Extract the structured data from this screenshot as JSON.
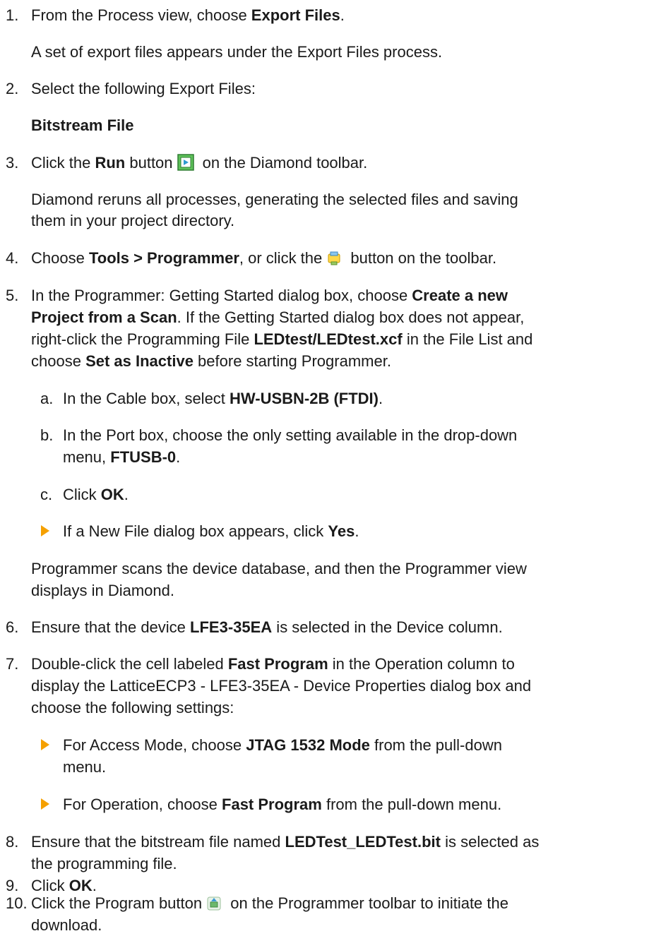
{
  "steps": [
    {
      "num": "1.",
      "pre": "From the Process view, choose ",
      "bold": "Export Files",
      "post": "."
    },
    {
      "note": "A set of export files appears under the Export Files process."
    },
    {
      "num": "2.",
      "text": "Select the following Export Files:"
    },
    {
      "boldline": "Bitstream File"
    },
    {
      "num": "3.",
      "pre": "Click the ",
      "bold": "Run",
      "post_a": " button",
      "post_b": " on the Diamond toolbar.",
      "icon": "run-icon"
    },
    {
      "note_l1": "Diamond reruns all processes, generating the selected files and saving",
      "note_l2": "them in your project directory."
    },
    {
      "num": "4.",
      "pre": "Choose ",
      "bold": "Tools > Programmer",
      "post_a": ", or click the",
      "post_b": " button on the toolbar.",
      "icon": "programmer-icon"
    },
    {
      "num": "5.",
      "l1_pre": "In the Programmer: Getting Started dialog box, choose ",
      "l1_bold": "Create a new",
      "l2_bold": "Project from a Scan",
      "l2_post": ". If the Getting Started dialog box does not appear,",
      "l3_pre": "right-click the Programming File ",
      "l3_bold": "LEDtest/LEDtest.xcf",
      "l3_post": " in the File List and",
      "l4_pre": "choose ",
      "l4_bold": "Set as Inactive",
      "l4_post": " before starting Programmer."
    },
    {
      "letter": "a.",
      "pre": "In the Cable box, select ",
      "bold": "HW-USBN-2B (FTDI)",
      "post": "."
    },
    {
      "letter": "b.",
      "l1": "In the Port box, choose the only setting available in the drop-down",
      "l2_pre": "menu, ",
      "l2_bold": "FTUSB-0",
      "l2_post": "."
    },
    {
      "letter": "c.",
      "pre": "Click ",
      "bold": "OK",
      "post": "."
    },
    {
      "bullet_pre": "If a New File dialog box appears, click ",
      "bullet_bold": "Yes",
      "bullet_post": "."
    },
    {
      "note_l1": "Programmer scans the device database, and then the Programmer view",
      "note_l2": "displays in Diamond."
    },
    {
      "num": "6.",
      "pre": "Ensure that the device ",
      "bold": "LFE3-35EA",
      "post": " is selected in the Device column."
    },
    {
      "num": "7.",
      "l1_pre": "Double-click the cell labeled ",
      "l1_bold": "Fast Program",
      "l1_post": " in the Operation column to",
      "l2": "display the LatticeECP3 - LFE3-35EA - Device Properties dialog box and",
      "l3": "choose the following settings:"
    },
    {
      "b1_pre": "For Access Mode, choose ",
      "b1_bold": "JTAG 1532 Mode",
      "b1_post": " from the pull-down",
      "b1_l2": "menu."
    },
    {
      "b2_pre": "For Operation, choose ",
      "b2_bold": "Fast Program",
      "b2_post": " from the pull-down menu."
    },
    {
      "num": "8.",
      "l1_pre": "Ensure that the bitstream file named ",
      "l1_bold": "LEDTest_LEDTest.bit",
      "l1_post": " is selected as",
      "l2": "the programming file."
    },
    {
      "num": "9.",
      "pre": "Click ",
      "bold": "OK",
      "post": "."
    },
    {
      "num": "10.",
      "pre": "Click the Program button",
      "post_b": " on the Programmer toolbar to initiate the",
      "l2": "download.",
      "icon": "program-icon"
    }
  ]
}
